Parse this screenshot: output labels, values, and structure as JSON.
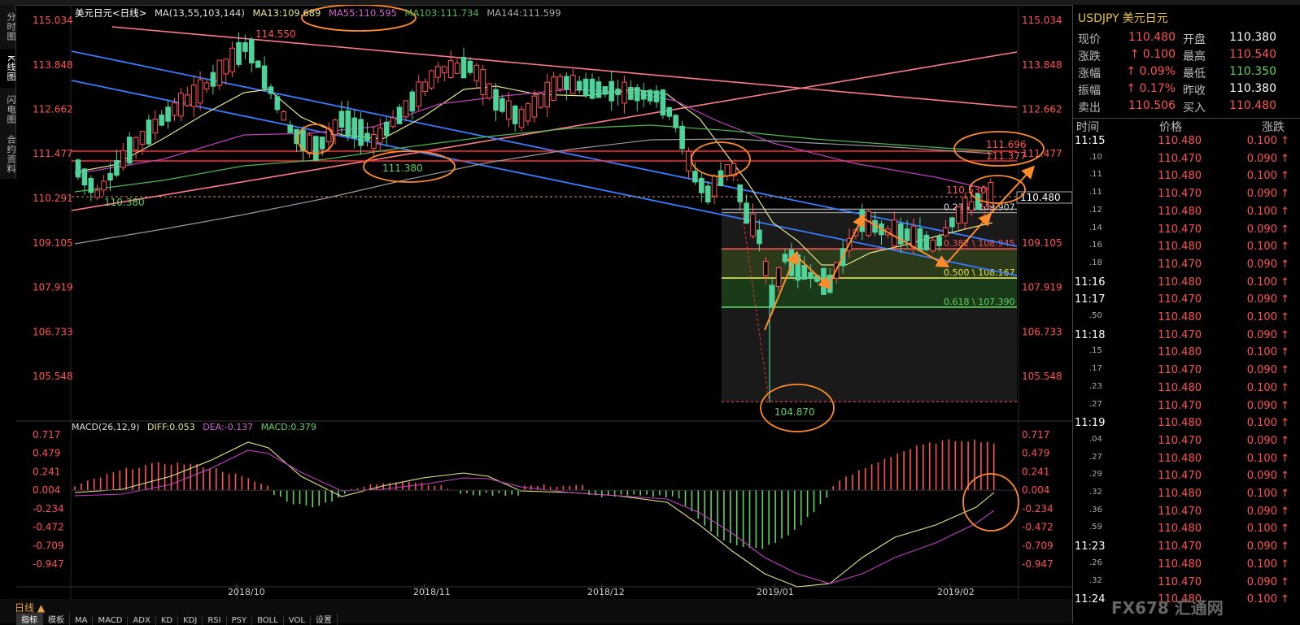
{
  "window": {
    "title": "美元日元<日线>"
  },
  "side_tabs": [
    "分时图",
    "K线图",
    "闪电图",
    "合约资料"
  ],
  "legend": {
    "title": "美元日元<日线>",
    "ma_label": "MA(13,55,103,144)",
    "ma13": "MA13:109.689",
    "ma55": "MA55:110.595",
    "ma103": "MA103:111.734",
    "ma144": "MA144:111.599"
  },
  "y_axis_ticks": [
    "115.034",
    "113.848",
    "112.662",
    "111.477",
    "110.291",
    "109.105",
    "107.919",
    "106.733",
    "105.548"
  ],
  "macd_legend": {
    "label": "MACD(26,12,9)",
    "diff": "DIFF:0.053",
    "dea": "DEA:-0.137",
    "macd": "MACD:0.379"
  },
  "macd_ticks": [
    "0.717",
    "0.479",
    "0.241",
    "0.004",
    "-0.234",
    "-0.472",
    "-0.709",
    "-0.947"
  ],
  "x_axis_labels": [
    "2018/10",
    "2018/11",
    "2018/12",
    "2019/01",
    "2019/02"
  ],
  "annotations": {
    "high": "114.550",
    "low": "104.870",
    "start_price": "110.380",
    "circle_level": "111.380",
    "level_111696": "111.696",
    "level_111377": "111.377",
    "last_marker": "110.530",
    "current_price_box": "110.480"
  },
  "fib_levels": [
    {
      "label": "0.236 \\ 109.907",
      "color": "#e0e0e0"
    },
    {
      "label": "0.382 \\ 108.945",
      "color": "#ff5252"
    },
    {
      "label": "0.500 \\ 108.167",
      "color": "#e6e64a"
    },
    {
      "label": "0.618 \\ 107.390",
      "color": "#5ed35e"
    }
  ],
  "bottom": {
    "period": "日线 ▲",
    "tabs": [
      "指标",
      "模板",
      "MA",
      "MACD",
      "ADX",
      "KD",
      "KDJ",
      "RSI",
      "PSY",
      "BOLL",
      "VOL",
      "设置"
    ]
  },
  "quote_panel": {
    "symbol": "USDJPY",
    "name": "美元日元",
    "rows": [
      {
        "l1": "现价",
        "v1": "110.480",
        "l2": "开盘",
        "v2": "110.380",
        "c2": "#ffffff"
      },
      {
        "l1": "涨跌",
        "v1": "↑ 0.100",
        "l2": "最高",
        "v2": "110.540",
        "c2": "#ff5252"
      },
      {
        "l1": "涨幅",
        "v1": "↑ 0.09%",
        "l2": "最低",
        "v2": "110.350",
        "c2": "#5ed35e"
      },
      {
        "l1": "振幅",
        "v1": "↑ 0.17%",
        "l2": "昨收",
        "v2": "110.380",
        "c2": "#ffffff"
      },
      {
        "l1": "卖出",
        "v1": "110.506",
        "l2": "买入",
        "v2": "110.480",
        "c2": "#ff5252"
      }
    ],
    "tick_header": {
      "time": "时间",
      "price": "价格",
      "change": "涨跌"
    },
    "ticks": [
      {
        "time": "11:15",
        "price": "110.480",
        "change": "0.100 ↑",
        "big": true
      },
      {
        "time": ".10",
        "price": "110.470",
        "change": "0.090 ↑",
        "big": false
      },
      {
        "time": ".11",
        "price": "110.480",
        "change": "0.100 ↑",
        "big": false
      },
      {
        "time": ".11",
        "price": "110.470",
        "change": "0.090 ↑",
        "big": false
      },
      {
        "time": ".12",
        "price": "110.480",
        "change": "0.100 ↑",
        "big": false
      },
      {
        "time": ".14",
        "price": "110.470",
        "change": "0.090 ↑",
        "big": false
      },
      {
        "time": ".16",
        "price": "110.480",
        "change": "0.100 ↑",
        "big": false
      },
      {
        "time": ".18",
        "price": "110.470",
        "change": "0.090 ↑",
        "big": false
      },
      {
        "time": "11:16",
        "price": "110.480",
        "change": "0.100 ↑",
        "big": true
      },
      {
        "time": "11:17",
        "price": "110.470",
        "change": "0.090 ↑",
        "big": true
      },
      {
        "time": ".50",
        "price": "110.480",
        "change": "0.100 ↑",
        "big": false
      },
      {
        "time": "11:18",
        "price": "110.470",
        "change": "0.090 ↑",
        "big": true
      },
      {
        "time": ".15",
        "price": "110.480",
        "change": "0.100 ↑",
        "big": false
      },
      {
        "time": ".17",
        "price": "110.470",
        "change": "0.090 ↑",
        "big": false
      },
      {
        "time": ".23",
        "price": "110.480",
        "change": "0.100 ↑",
        "big": false
      },
      {
        "time": ".27",
        "price": "110.470",
        "change": "0.090 ↑",
        "big": false
      },
      {
        "time": "11:19",
        "price": "110.480",
        "change": "0.100 ↑",
        "big": true
      },
      {
        "time": ".04",
        "price": "110.470",
        "change": "0.090 ↑",
        "big": false
      },
      {
        "time": ".27",
        "price": "110.480",
        "change": "0.100 ↑",
        "big": false
      },
      {
        "time": ".29",
        "price": "110.470",
        "change": "0.090 ↑",
        "big": false
      },
      {
        "time": ".32",
        "price": "110.480",
        "change": "0.100 ↑",
        "big": false
      },
      {
        "time": ".36",
        "price": "110.470",
        "change": "0.090 ↑",
        "big": false
      },
      {
        "time": ".59",
        "price": "110.480",
        "change": "0.100 ↑",
        "big": false
      },
      {
        "time": "11:23",
        "price": "110.470",
        "change": "0.090 ↑",
        "big": true
      },
      {
        "time": ".26",
        "price": "110.480",
        "change": "0.100 ↑",
        "big": false
      },
      {
        "time": ".32",
        "price": "110.470",
        "change": "0.090 ↑",
        "big": false
      },
      {
        "time": "11:24",
        "price": "110.480",
        "change": "0.100 ↑",
        "big": true
      }
    ]
  },
  "watermark": "FX678 汇通网",
  "colors": {
    "up": "#ff5252",
    "down": "#4fd39a",
    "ma13": "#e6e68a",
    "ma55": "#c040c0",
    "ma103": "#4fb84f",
    "ma144": "#9a9a9a",
    "channel": "#3a7bff",
    "annotation": "#ff8c2a",
    "fib_red": "#ff5252"
  }
}
